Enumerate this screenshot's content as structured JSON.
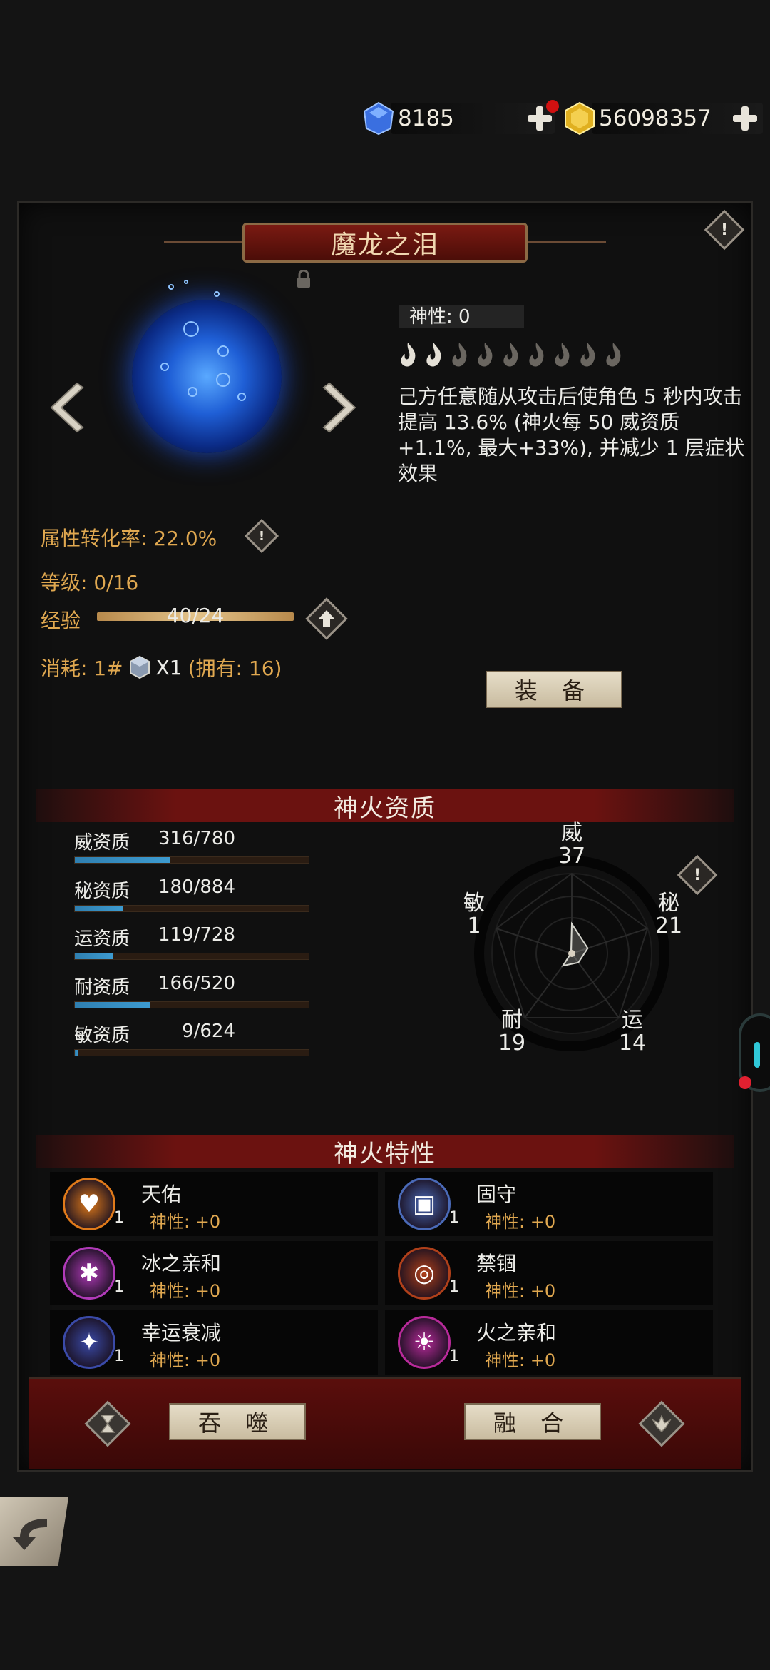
{
  "currency": {
    "gems": "8185",
    "gold": "56098357"
  },
  "item": {
    "title": "魔龙之泪",
    "divinity": "神性: 0",
    "description": "己方任意随从攻击后使角色 5 秒内攻击提高 13.6% (神火每 50 威资质+1.1%, 最大+33%), 并减少 1 层症状效果",
    "conversion_rate": "属性转化率: 22.0%",
    "level": "等级: 0/16",
    "exp_label": "经验",
    "exp_value": "40/24",
    "exp_progress": 1.0,
    "cost": "消耗: 1#",
    "cost_qty": "X1",
    "cost_owned": "(拥有: 16)",
    "equip_button": "装 备",
    "flame_marks_total": 9,
    "flame_marks_filled": 2
  },
  "aptitude": {
    "section_title": "神火资质",
    "rows": [
      {
        "label": "威资质",
        "value": "316/780",
        "ratio": 0.405
      },
      {
        "label": "秘资质",
        "value": "180/884",
        "ratio": 0.204
      },
      {
        "label": "运资质",
        "value": "119/728",
        "ratio": 0.163
      },
      {
        "label": "耐资质",
        "value": "166/520",
        "ratio": 0.319
      },
      {
        "label": "敏资质",
        "value": "9/624",
        "ratio": 0.014
      }
    ],
    "radar": {
      "wei": {
        "name": "威",
        "value": "37"
      },
      "mi": {
        "name": "秘",
        "value": "21"
      },
      "yun": {
        "name": "运",
        "value": "14"
      },
      "nai": {
        "name": "耐",
        "value": "19"
      },
      "min": {
        "name": "敏",
        "value": "1"
      }
    }
  },
  "traits": {
    "section_title": "神火特性",
    "items": [
      {
        "name": "天佑",
        "level": "1",
        "divinity": "神性: +0",
        "color": "#e07a1a",
        "icon": "heart-icon"
      },
      {
        "name": "固守",
        "level": "1",
        "divinity": "神性: +0",
        "color": "#4a6ab8",
        "icon": "shield-icon"
      },
      {
        "name": "冰之亲和",
        "level": "1",
        "divinity": "神性: +0",
        "color": "#b03ab8",
        "icon": "snowflake-icon"
      },
      {
        "name": "禁锢",
        "level": "1",
        "divinity": "神性: +0",
        "color": "#b0401a",
        "icon": "spiral-icon"
      },
      {
        "name": "幸运衰减",
        "level": "1",
        "divinity": "神性: +0",
        "color": "#3a4aa8",
        "icon": "star-arrow-icon"
      },
      {
        "name": "火之亲和",
        "level": "1",
        "divinity": "神性: +0",
        "color": "#b82a9a",
        "icon": "flame-icon"
      }
    ]
  },
  "footer": {
    "devour_button": "吞 噬",
    "merge_button": "融 合"
  }
}
